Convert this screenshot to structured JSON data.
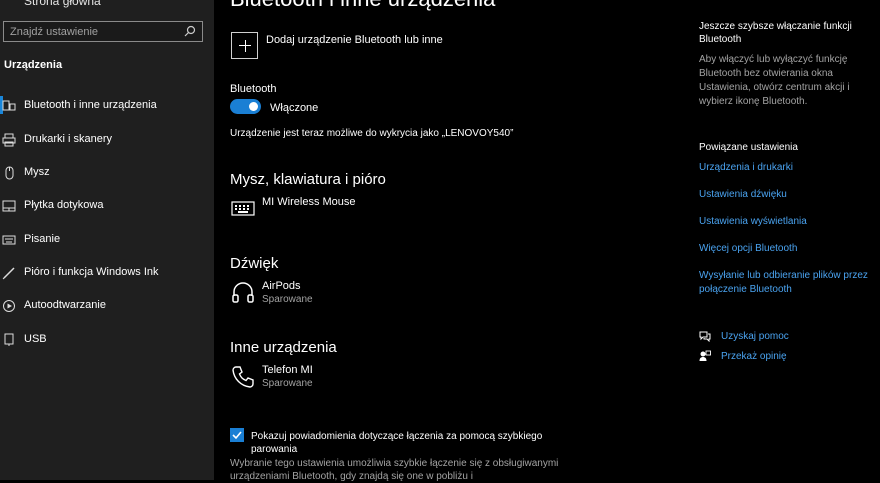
{
  "sidebar": {
    "home_label": "Strona główna",
    "search_placeholder": "Znajdź ustawienie",
    "section_title": "Urządzenia",
    "items": [
      {
        "label": "Bluetooth i inne urządzenia",
        "icon": "bluetooth-devices-icon"
      },
      {
        "label": "Drukarki i skanery",
        "icon": "printer-icon"
      },
      {
        "label": "Mysz",
        "icon": "mouse-icon"
      },
      {
        "label": "Płytka dotykowa",
        "icon": "touchpad-icon"
      },
      {
        "label": "Pisanie",
        "icon": "keyboard-icon"
      },
      {
        "label": "Pióro i funkcja Windows Ink",
        "icon": "pen-icon"
      },
      {
        "label": "Autoodtwarzanie",
        "icon": "autoplay-icon"
      },
      {
        "label": "USB",
        "icon": "usb-icon"
      }
    ]
  },
  "main": {
    "title": "Bluetooth i inne urządzenia",
    "add_device_label": "Dodaj urządzenie Bluetooth lub inne",
    "bluetooth_label": "Bluetooth",
    "toggle_state_label": "Włączone",
    "discoverable_text": "Urządzenie jest teraz możliwe do wykrycia jako „LENOVOY540”",
    "groups": [
      {
        "title": "Mysz, klawiatura i pióro",
        "devices": [
          {
            "name": "MI Wireless Mouse",
            "status": "",
            "icon": "keyboard-icon"
          }
        ]
      },
      {
        "title": "Dźwięk",
        "devices": [
          {
            "name": "AirPods",
            "status": "Sparowane",
            "icon": "headphones-icon"
          }
        ]
      },
      {
        "title": "Inne urządzenia",
        "devices": [
          {
            "name": "Telefon MI",
            "status": "Sparowane",
            "icon": "phone-icon"
          }
        ]
      }
    ],
    "swift_pair_label": "Pokazuj powiadomienia dotyczące łączenia za pomocą szybkiego parowania",
    "swift_pair_desc": "Wybranie tego ustawienia umożliwia szybkie łączenie się z obsługiwanymi urządzeniami Bluetooth, gdy znajdą się one w pobliżu i"
  },
  "right_panel": {
    "title": "Jeszcze szybsze włączanie funkcji Bluetooth",
    "text": "Aby włączyć lub wyłączyć funkcję Bluetooth bez otwierania okna Ustawienia, otwórz centrum akcji i wybierz ikonę Bluetooth.",
    "related_title": "Powiązane ustawienia",
    "links": [
      "Urządzenia i drukarki",
      "Ustawienia dźwięku",
      "Ustawienia wyświetlania",
      "Więcej opcji Bluetooth",
      "Wysyłanie lub odbieranie plików przez połączenie Bluetooth"
    ],
    "help_label": "Uzyskaj pomoc",
    "feedback_label": "Przekaż opinię"
  },
  "colors": {
    "accent": "#1a7fd4",
    "link": "#4aa3f0",
    "sidebar_bg": "#1f1f1f",
    "main_bg": "#000000"
  }
}
